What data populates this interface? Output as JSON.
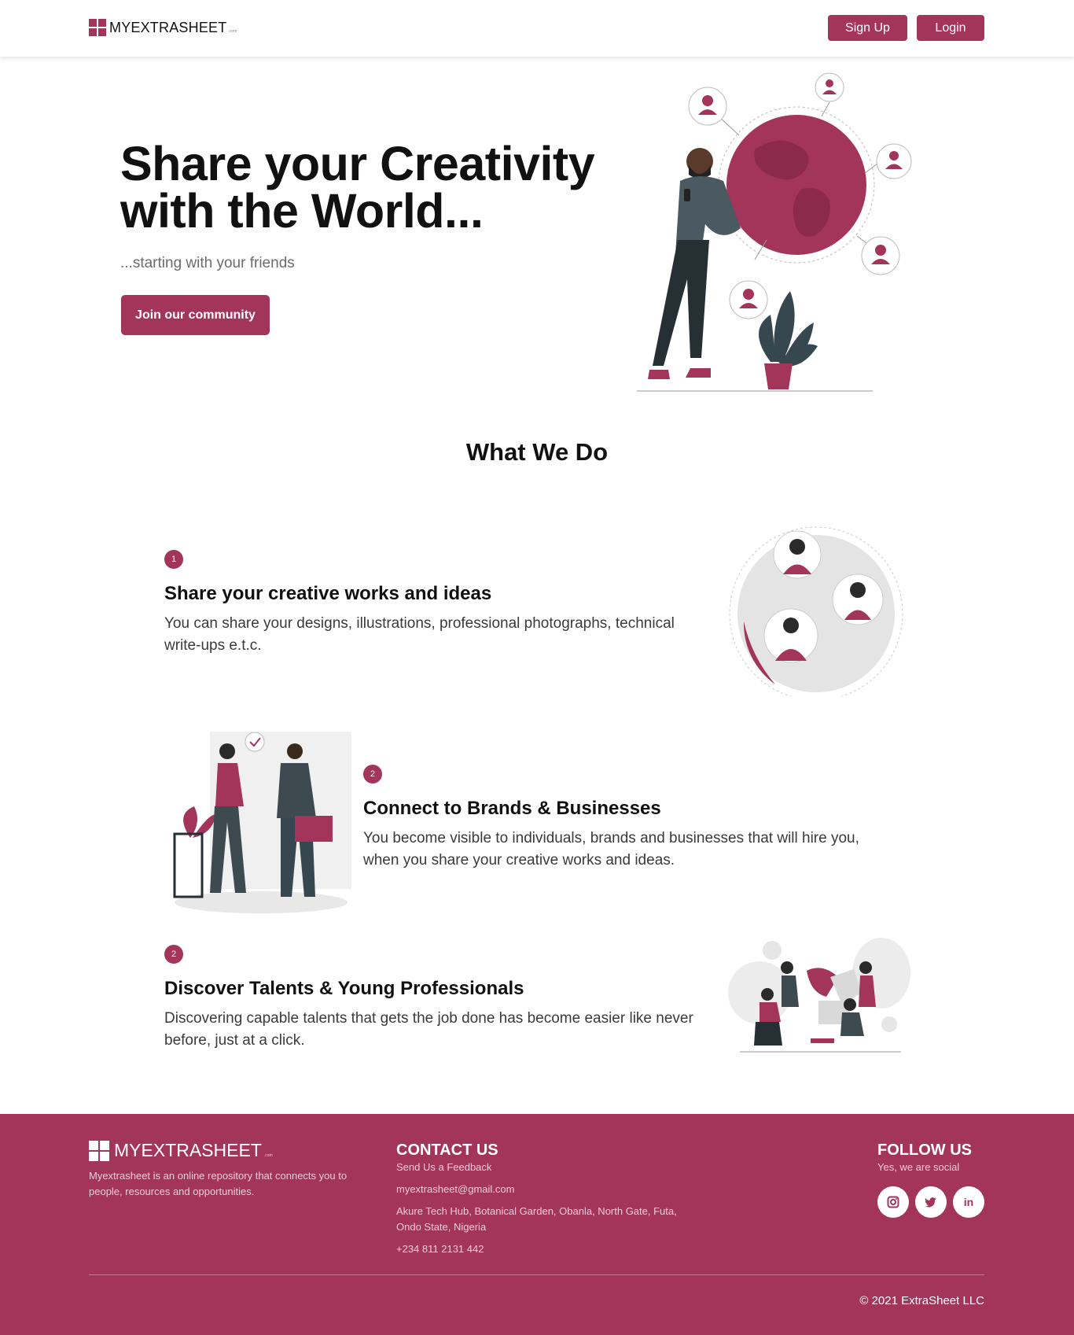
{
  "colors": {
    "accent": "#a3345a",
    "dark_figure": "#3d4a4f",
    "light_gray": "#e6e6e6"
  },
  "nav": {
    "logo_text": "MYEXTRASHEET",
    "logo_suffix": ".com",
    "signup_label": "Sign Up",
    "login_label": "Login"
  },
  "hero": {
    "title": "Share your Creativity with the World...",
    "subtitle": "...starting with your friends",
    "cta_label": "Join our community"
  },
  "what_we_do": {
    "title": "What We Do",
    "features": [
      {
        "number": "1",
        "title": "Share your creative works and ideas",
        "description": "You can share your designs, illustrations, professional photographs, technical write-ups e.t.c."
      },
      {
        "number": "2",
        "title": "Connect to Brands & Businesses",
        "description": "You become visible to individuals, brands and businesses that will hire you, when you share your creative works and ideas."
      },
      {
        "number": "2",
        "title": "Discover Talents & Young Professionals",
        "description": "Discovering capable talents that gets the job done has become easier like never before, just at a click."
      }
    ]
  },
  "footer": {
    "logo_text": "MYEXTRASHEET",
    "logo_suffix": ".com",
    "about": "Myextrasheet is an online repository that connects you to people, resources and opportunities.",
    "contact": {
      "heading": "CONTACT US",
      "feedback": "Send Us a Feedback",
      "email": "myextrasheet@gmail.com",
      "address": "Akure Tech Hub, Botanical Garden, Obanla, North Gate, Futa, Ondo State, Nigeria",
      "phone": "+234 811 2131 442"
    },
    "follow": {
      "heading": "FOLLOW US",
      "tagline": "Yes, we are social",
      "icons": [
        "instagram-icon",
        "twitter-icon",
        "linkedin-icon"
      ],
      "linkedin_glyph": "in"
    },
    "copyright": "© 2021 ExtraSheet LLC"
  }
}
